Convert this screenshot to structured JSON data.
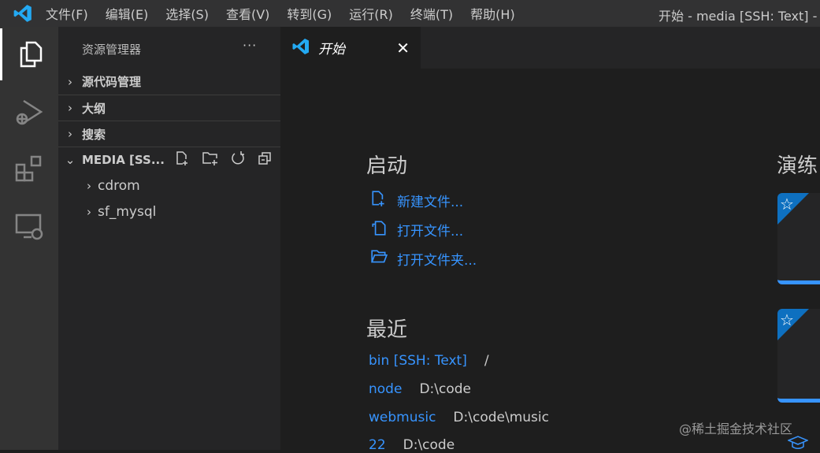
{
  "titlebar": {
    "menus": [
      "文件(F)",
      "编辑(E)",
      "选择(S)",
      "查看(V)",
      "转到(G)",
      "运行(R)",
      "终端(T)",
      "帮助(H)"
    ],
    "title": "开始 - media [SSH: Text] -"
  },
  "sidebar": {
    "title": "资源管理器",
    "more": "···",
    "sections": [
      "源代码管理",
      "大纲",
      "搜索"
    ],
    "workspace": "MEDIA [SS...",
    "tree": [
      "cdrom",
      "sf_mysql"
    ]
  },
  "tab": {
    "label": "开始",
    "close": "✕"
  },
  "start": {
    "heading": "启动",
    "links": [
      "新建文件...",
      "打开文件...",
      "打开文件夹..."
    ]
  },
  "recent": {
    "heading": "最近",
    "items": [
      {
        "name": "bin [SSH: Text]",
        "path": "/"
      },
      {
        "name": "node",
        "path": "D:\\code"
      },
      {
        "name": "webmusic",
        "path": "D:\\code\\music"
      },
      {
        "name": "22",
        "path": "D:\\code"
      }
    ]
  },
  "walkthrough": {
    "heading": "演练"
  },
  "watermark": "@稀土掘金技术社区",
  "colors": {
    "accent": "#3794ff",
    "star_bg": "#0e70c0"
  }
}
